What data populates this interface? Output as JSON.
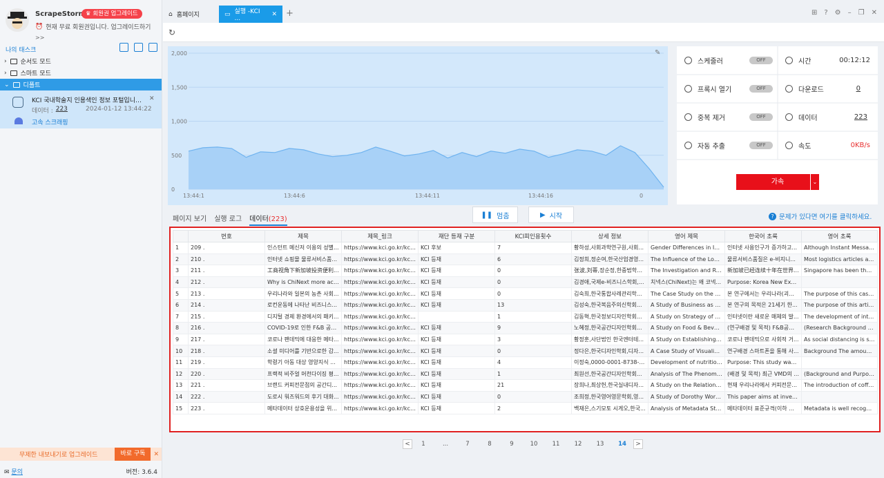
{
  "app": {
    "name": "ScrapeStorm",
    "upgrade_badge": "회원권 업그레이드",
    "free_line": "현재 무료 회원권입니다. 업그레이드하기",
    "more": ">>",
    "version": "버전: 3.6.4"
  },
  "sidebar": {
    "my_tasks": "나의 태스크",
    "tree": [
      {
        "label": "순서도 모드"
      },
      {
        "label": "스마트 모드"
      },
      {
        "label": "디폴트"
      }
    ],
    "task": {
      "title": "KCI 국내학술지 인용색인 정보 포털입니다.-...",
      "data_label": "데이터 :",
      "data_count": "223",
      "date": "2024-01-12 13:44:22",
      "speed_label": "고속 스크래핑"
    },
    "promo": {
      "text": "무제한 내보내기로 업그레이드",
      "button": "바로 구독"
    },
    "contact": "문의"
  },
  "tabs": [
    {
      "label": "홈페이지"
    },
    {
      "label": "실행 -KCI ..."
    }
  ],
  "chart_data": {
    "type": "area",
    "yticks": [
      "2,000",
      "1,500",
      "1,000",
      "500",
      "0"
    ],
    "xticks": [
      "13:44:1",
      "13:44:6",
      "13:44:11",
      "13:44:16",
      "0"
    ],
    "ylim": [
      0,
      2000
    ],
    "values": [
      560,
      610,
      620,
      600,
      470,
      550,
      540,
      600,
      580,
      520,
      480,
      500,
      540,
      620,
      560,
      490,
      520,
      570,
      460,
      540,
      480,
      560,
      530,
      590,
      560,
      470,
      520,
      580,
      560,
      500,
      640,
      540,
      300,
      30
    ]
  },
  "stats": {
    "scheduler": "스케줄러",
    "proxy": "프록시 열기",
    "dedupe": "중복 제거",
    "auto_export": "자동 추출",
    "off": "OFF",
    "time_label": "시간",
    "time": "00:12:12",
    "download_label": "다운로드",
    "download": "0",
    "data_label": "데이터",
    "data": "223",
    "speed_label": "속도",
    "speed": "0KB/s",
    "accel": "가속"
  },
  "view": {
    "page": "페이지 보기",
    "log": "실행 로그",
    "data": "데이터",
    "data_count": "(223)",
    "pause": "멈춤",
    "start": "시작",
    "help": "문제가 있다면 여기를 클릭하세요."
  },
  "table": {
    "headers": [
      "",
      "번호",
      "제목",
      "제목_링크",
      "재단 등재 구분",
      "KCI피인용횟수",
      "상세 정보",
      "영어 제목",
      "한국어 초록",
      "영어 초록"
    ],
    "rows": [
      [
        "1",
        "209 .",
        "인스턴트 메신저 이용의 성별...",
        "https://www.kci.go.kr/kciport...",
        "KCI 후보",
        "7",
        "황하성,사회과학연구원,사회...",
        "Gender Differences in Insta...",
        "인터넷 사용인구가 증가하고...",
        "Although Instant Messaging..."
      ],
      [
        "2",
        "210 .",
        "인터넷 쇼핑몰 물류서비스품...",
        "https://www.kci.go.kr/kciport...",
        "KCI 등재",
        "6",
        "김정희,정순여,한국산업경영...",
        "The Influence of the Logisti...",
        "물류서비스품질은 e-비지니...",
        "Most logistics articles agree..."
      ],
      [
        "3",
        "211 .",
        "工商视角下新加坡投资便利...",
        "https://www.kci.go.kr/kciport...",
        "KCI 등재",
        "0",
        "张波,刘蒂,장순정,한중법학회...",
        "The Investigation and Refe...",
        "新加坡已经连续十年在世界...",
        "Singapore has been the firs..."
      ],
      [
        "4",
        "212 .",
        "Why is ChiNext more active...",
        "https://www.kci.go.kr/kciport...",
        "KCI 등재",
        "0",
        "김경애,국제e-비즈니스학회,...",
        "치넥스(ChiNext)는 왜 코넥...",
        "Purpose: Korea New Excha...",
        ""
      ],
      [
        "5",
        "213 .",
        "우리나라와 일본의 농촌 사회...",
        "https://www.kci.go.kr/kciport...",
        "KCI 등재",
        "0",
        "김숙희,한국통합사례관리학...",
        "The Case Study on the Rur...",
        "본 연구에서는 우리나라(괴...",
        "The purpose of this case stu..."
      ],
      [
        "6",
        "214 .",
        "로컨운동에 나타난 비즈니스...",
        "https://www.kci.go.kr/kciport...",
        "KCI 등재",
        "13",
        "김성숙,한국복음주의신학회...",
        "A Study of Business as Mis...",
        "본 연구의 목적은 21세기 한...",
        "The purpose of this article i..."
      ],
      [
        "7",
        "215 .",
        "디지털 경제 환경에서의 패키...",
        "https://www.kci.go.kr/kciport...",
        "",
        "1",
        "김동혁,한국정보디자인학회...",
        "A Study on Strategy of Pack...",
        "인터넷이란 새로운 매체의 발...",
        "The development of interne..."
      ],
      [
        "8",
        "216 .",
        "COVID-19로 인한 F&B 공간...",
        "https://www.kci.go.kr/kciport...",
        "KCI 등재",
        "9",
        "노혜정,한국공간디자인학회...",
        "A Study on Food & Beverag...",
        "(연구배경 및 목적) F&B공간...",
        "(Research Background and..."
      ],
      [
        "9",
        "217 .",
        "코로나 팬데믹에 대응한 메타...",
        "https://www.kci.go.kr/kciport...",
        "KCI 등재",
        "3",
        "황정훈,사단법인 한국엔터테...",
        "A Study on Establishing Me...",
        "코로나 팬데믹으로 사회적 거...",
        "As social distancing is stren..."
      ],
      [
        "10",
        "218 .",
        "소셜 미디어를 기반으로한 감...",
        "https://www.kci.go.kr/kciport...",
        "KCI 등재",
        "0",
        "정다은,한국디자인학회,디자...",
        "A Case Study of Visualizing...",
        "연구배경 스마트폰을 통해 사...",
        "Background The amount of..."
      ],
      [
        "11",
        "219 .",
        "학령기 아동 대상 영양지식 ...",
        "https://www.kci.go.kr/kciport...",
        "KCI 등재",
        "4",
        "이정숙,0000-0001-8738-64...",
        "Development of nutrition qu...",
        "Purpose: This study was un...",
        ""
      ],
      [
        "12",
        "220 .",
        "프랙적 비주얼 머천다이징 평...",
        "https://www.kci.go.kr/kciport...",
        "KCI 등재",
        "1",
        "최원선,한국공간디자인학회...",
        "Analysis of The Phenomen...",
        "(배경 및 목적) 최근 VMD의 ...",
        "(Background and Purpose) ..."
      ],
      [
        "13",
        "221 .",
        "브랜드 커피전문점의 공간디...",
        "https://www.kci.go.kr/kciport...",
        "KCI 등재",
        "21",
        "장희나,최상헌,한국실내디자...",
        "A Study on the Relationship...",
        "현재 우리나라에서 커피전문...",
        "The introduction of coffee b..."
      ],
      [
        "14",
        "222 .",
        "도로시 워즈워드의 후기 대화...",
        "https://www.kci.go.kr/kciport...",
        "KCI 등재",
        "0",
        "조희정,한국영어영문학회,영...",
        "A Study of Dorothy Wordsw...",
        "This paper aims at investig...",
        ""
      ],
      [
        "15",
        "223 .",
        "메타데이터 상호운용성을 위...",
        "https://www.kci.go.kr/kciport...",
        "KCI 등재",
        "2",
        "백재은,스기모토 시게오,한국...",
        "Analysis of Metadata Stand...",
        "메타데이터 표준규격(이하 ...",
        "Metadata is well recognized..."
      ]
    ]
  },
  "pager": {
    "pages": [
      "1",
      "...",
      "7",
      "8",
      "9",
      "10",
      "11",
      "12",
      "13",
      "14"
    ],
    "current": "14",
    "prev": "<",
    "next": ">"
  }
}
